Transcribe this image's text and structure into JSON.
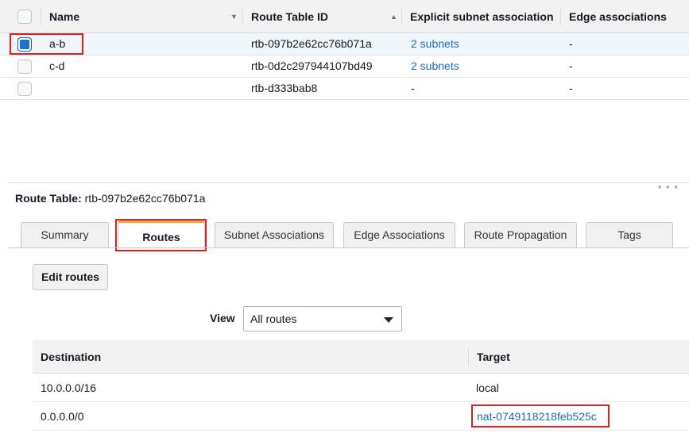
{
  "route_tables": {
    "columns": {
      "name": "Name",
      "route_table_id": "Route Table ID",
      "explicit_subnet": "Explicit subnet association",
      "edge": "Edge associations"
    },
    "rows": [
      {
        "name": "a-b",
        "id": "rtb-097b2e62cc76b071a",
        "explicit": "2 subnets",
        "edge": "-",
        "selected": true
      },
      {
        "name": "c-d",
        "id": "rtb-0d2c297944107bd49",
        "explicit": "2 subnets",
        "edge": "-",
        "selected": false
      },
      {
        "name": "",
        "id": "rtb-d333bab8",
        "explicit": "-",
        "edge": "-",
        "selected": false
      }
    ]
  },
  "detail": {
    "title_label": "Route Table:",
    "title_value": "rtb-097b2e62cc76b071a",
    "tabs": [
      "Summary",
      "Routes",
      "Subnet Associations",
      "Edge Associations",
      "Route Propagation",
      "Tags"
    ],
    "active_tab": "Routes",
    "edit_routes_label": "Edit routes",
    "view_label": "View",
    "view_selected": "All routes"
  },
  "routes": {
    "columns": {
      "destination": "Destination",
      "target": "Target"
    },
    "rows": [
      {
        "destination": "10.0.0.0/16",
        "target": "local"
      },
      {
        "destination": "0.0.0.0/0",
        "target": "nat-0749118218feb525c"
      }
    ]
  },
  "colors": {
    "accent_tab": "#f2a33a",
    "link": "#1d6eb5",
    "highlight": "#e02020",
    "checkbox_checked": "#1f73c8"
  },
  "icons": {
    "sort_name": "sort-neutral-icon",
    "sort_id": "sort-ascending-icon",
    "select": "chevron-down-icon",
    "resize": "resize-grip-icon"
  }
}
